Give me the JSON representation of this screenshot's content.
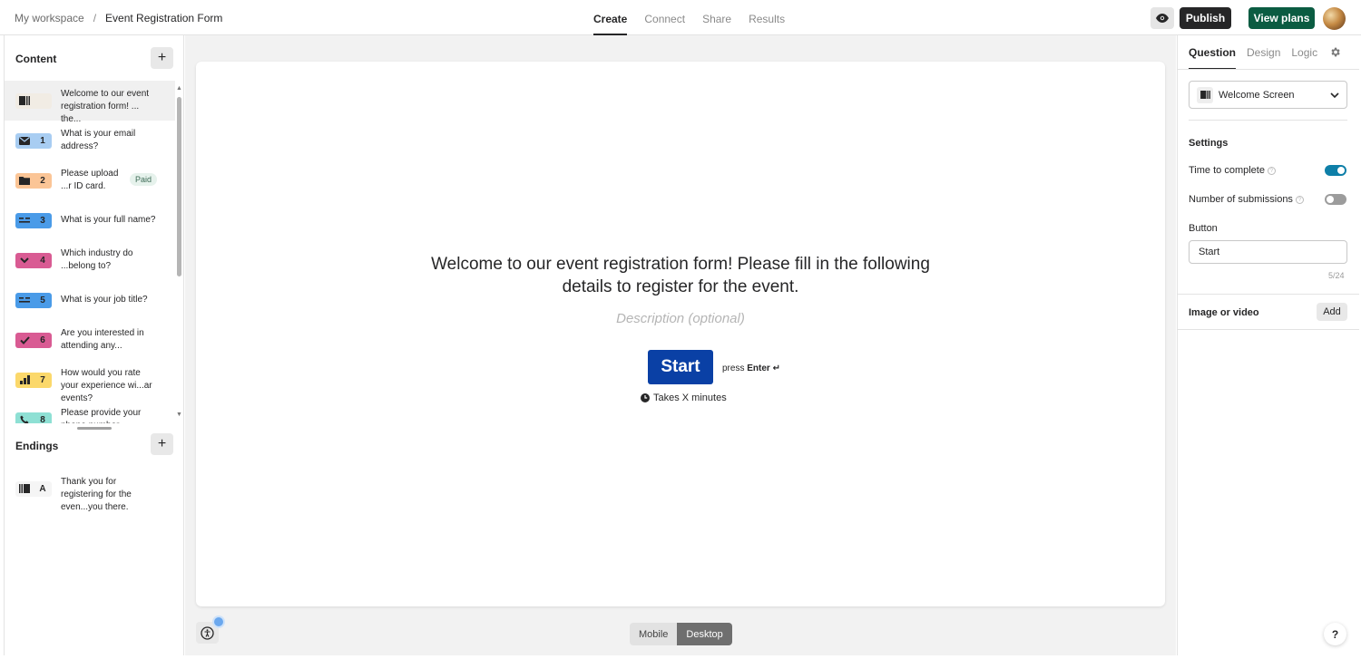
{
  "breadcrumb": {
    "workspace": "My workspace",
    "separator": "/",
    "form": "Event Registration Form"
  },
  "top_tabs": [
    {
      "label": "Create",
      "active": true
    },
    {
      "label": "Connect",
      "active": false
    },
    {
      "label": "Share",
      "active": false
    },
    {
      "label": "Results",
      "active": false
    }
  ],
  "top_actions": {
    "preview_icon": "eye-icon",
    "publish_label": "Publish",
    "plans_label": "View plans",
    "colors": {
      "publish": "#262627",
      "plans": "#0b5c42"
    }
  },
  "content": {
    "title": "Content",
    "add_label": "+",
    "items": [
      {
        "num": "",
        "icon": "welcome-screen-icon",
        "color": "#f1ece4",
        "text": "Welcome to our event registration form! ... the..."
      },
      {
        "num": "1",
        "icon": "envelope-icon",
        "color": "#a8cdf2",
        "text": "What is your email address?"
      },
      {
        "num": "2",
        "icon": "folder-icon",
        "color": "#fbc596",
        "text": "Please upload ...r ID card.",
        "badge": "Paid"
      },
      {
        "num": "3",
        "icon": "short-text-icon",
        "color": "#4a9be8",
        "text": "What is your full name?"
      },
      {
        "num": "4",
        "icon": "chevron-down-icon",
        "color": "#d95b93",
        "text": "Which industry do ...belong to?"
      },
      {
        "num": "5",
        "icon": "short-text-icon",
        "color": "#4a9be8",
        "text": "What is your job title?"
      },
      {
        "num": "6",
        "icon": "check-icon",
        "color": "#d95b93",
        "text": "Are you interested in attending any..."
      },
      {
        "num": "7",
        "icon": "bar-chart-icon",
        "color": "#fbd86b",
        "text": "How would you rate your experience wi...ar events?"
      },
      {
        "num": "8",
        "icon": "phone-icon",
        "color": "#8ee0d4",
        "text": "Please provide your phone number..."
      }
    ]
  },
  "endings": {
    "title": "Endings",
    "add_label": "+",
    "items": [
      {
        "num": "A",
        "icon": "ending-screen-icon",
        "text": "Thank you for registering for the even...you there."
      }
    ]
  },
  "canvas": {
    "title": "Welcome to our event registration form! Please fill in the following details to register for the event.",
    "description_placeholder": "Description (optional)",
    "start_label": "Start",
    "press_prefix": "press",
    "press_key": "Enter ↵",
    "takes_text": "Takes X minutes",
    "button_color": "#0a40a5"
  },
  "view_toggle": {
    "mobile": "Mobile",
    "desktop": "Desktop",
    "active": "Desktop"
  },
  "right_panel": {
    "tabs": [
      {
        "label": "Question",
        "active": true
      },
      {
        "label": "Design",
        "active": false
      },
      {
        "label": "Logic",
        "active": false
      }
    ],
    "type_select": "Welcome Screen",
    "settings_title": "Settings",
    "time_to_complete": {
      "label": "Time to complete",
      "on": true
    },
    "number_of_submissions": {
      "label": "Number of submissions",
      "on": false
    },
    "button_label": "Button",
    "button_value": "Start",
    "counter": "5/24",
    "image_or_video": "Image or video",
    "add_label": "Add",
    "help_label": "?"
  }
}
